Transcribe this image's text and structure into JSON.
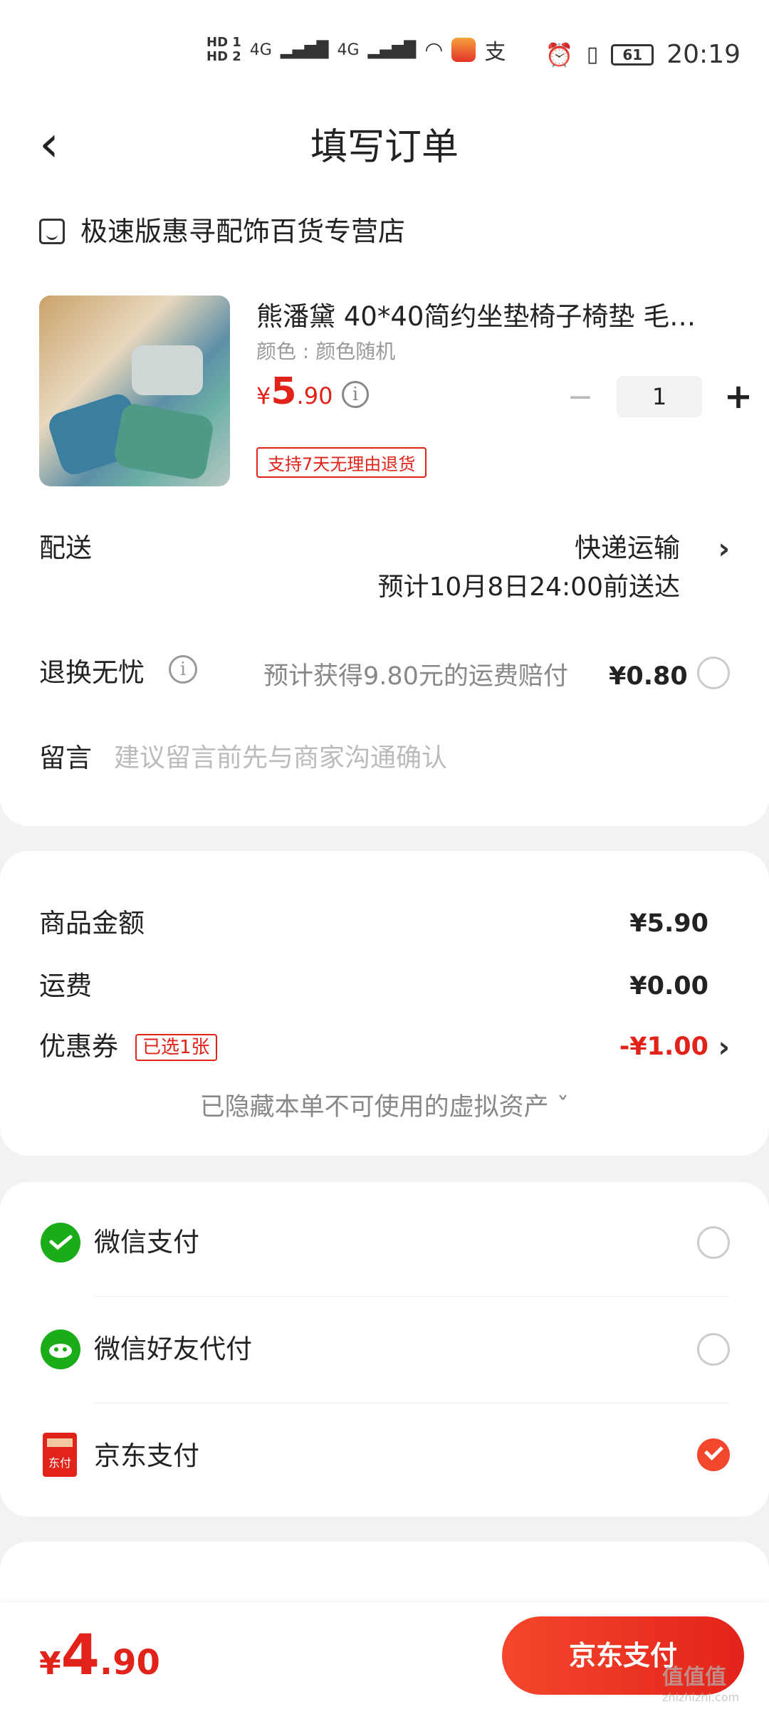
{
  "status": {
    "time": "20:19",
    "battery": "61",
    "hd1": "HD 1",
    "hd2": "HD 2",
    "net": "4G"
  },
  "nav": {
    "title": "填写订单",
    "back": "‹"
  },
  "shop": {
    "name": "极速版惠寻配饰百货专营店"
  },
  "product": {
    "title": "熊潘黛 40*40简约坐垫椅子椅垫 毛…",
    "spec": "颜色 : 颜色随机",
    "price_symbol": "¥",
    "price_int": "5",
    "price_dec": ".90",
    "qty": "1",
    "tag": "支持7天无理由退货"
  },
  "delivery": {
    "label": "配送",
    "method": "快递运输",
    "eta": "预计10月8日24:00前送达"
  },
  "insurance": {
    "label": "退换无忧",
    "desc": "预计获得9.80元的运费赔付",
    "price": "¥0.80"
  },
  "message": {
    "label": "留言",
    "placeholder": "建议留言前先与商家沟通确认"
  },
  "summary": {
    "goods_label": "商品金额",
    "goods_value": "¥5.90",
    "shipping_label": "运费",
    "shipping_value": "¥0.00",
    "coupon_label": "优惠券",
    "coupon_badge": "已选1张",
    "coupon_value": "-¥1.00",
    "hidden_assets": "已隐藏本单不可使用的虚拟资产 ˇ"
  },
  "payments": [
    {
      "label": "微信支付",
      "selected": false
    },
    {
      "label": "微信好友代付",
      "selected": false
    },
    {
      "label": "京东支付",
      "selected": true
    }
  ],
  "jd_icon_text": "东付",
  "bottom": {
    "total_symbol": "¥",
    "total_int": "4",
    "total_dec": ".90",
    "pay_button": "京东支付"
  },
  "watermark": {
    "main": "值值值",
    "sub": "zhizhizhi.com"
  },
  "colors": {
    "accent": "#e2231a",
    "wechat": "#1aad19",
    "button": "#f4472c"
  }
}
